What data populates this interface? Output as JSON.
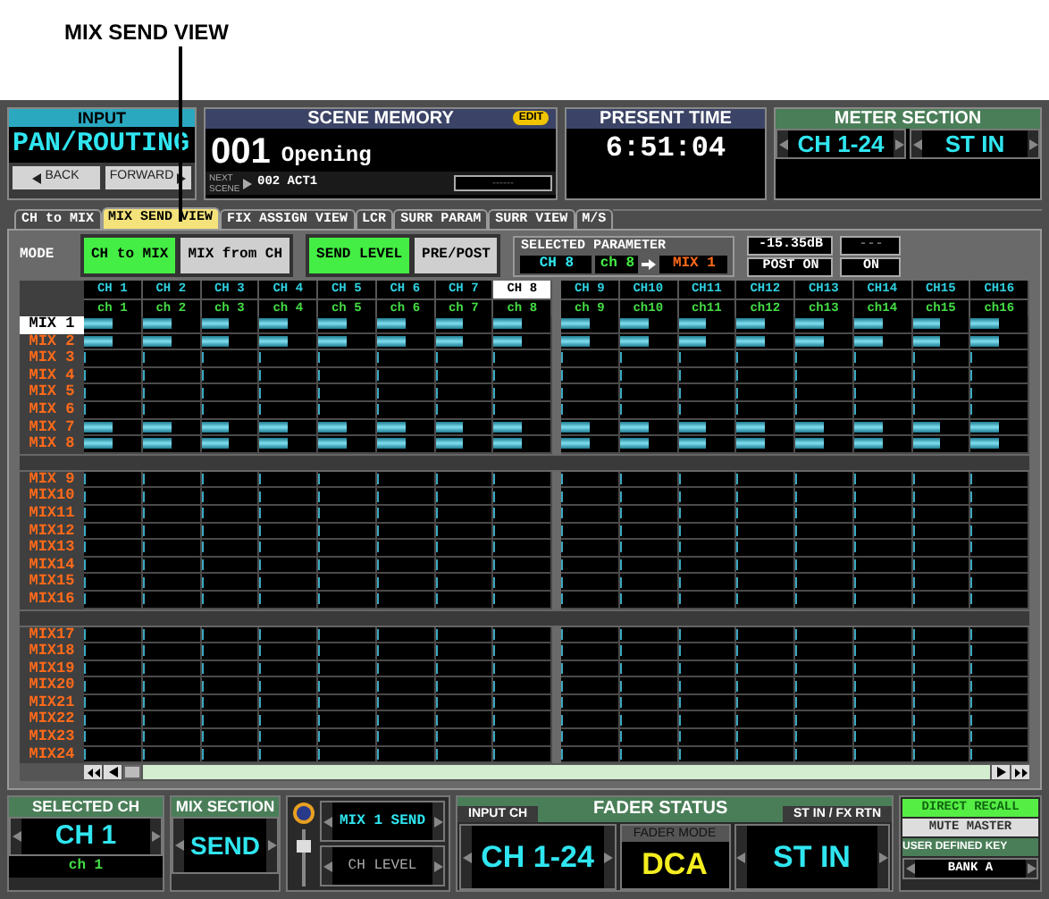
{
  "callout": "MIX SEND VIEW",
  "input_panel": {
    "title": "INPUT",
    "value": "PAN/ROUTING",
    "back": "BACK",
    "forward": "FORWARD"
  },
  "scene_memory": {
    "title": "SCENE MEMORY",
    "badge": "EDIT",
    "number": "001",
    "name": "Opening",
    "next_label": "NEXT SCENE",
    "next": "002 ACT1",
    "field": "------"
  },
  "present_time": {
    "title": "PRESENT TIME",
    "time": "6:51:04"
  },
  "meter_section": {
    "title": "METER SECTION",
    "selectors": [
      "CH 1-24",
      "ST IN"
    ]
  },
  "tabs": [
    {
      "label": "CH to MIX",
      "selected": false
    },
    {
      "label": "MIX SEND VIEW",
      "selected": true
    },
    {
      "label": "FIX ASSIGN VIEW",
      "selected": false
    },
    {
      "label": "LCR",
      "selected": false
    },
    {
      "label": "SURR PARAM",
      "selected": false
    },
    {
      "label": "SURR VIEW",
      "selected": false
    },
    {
      "label": "M/S",
      "selected": false
    }
  ],
  "mode": {
    "label": "MODE",
    "buttons": [
      {
        "label": "CH to MIX",
        "selected": true
      },
      {
        "label": "MIX from CH",
        "selected": false
      }
    ],
    "view_buttons": [
      {
        "label": "SEND LEVEL",
        "selected": true
      },
      {
        "label": "PRE/POST",
        "selected": false
      }
    ]
  },
  "selected_parameter": {
    "title": "SELECTED PARAMETER",
    "channel": "CH 8",
    "name": "ch 8",
    "mix": "MIX 1",
    "value": "-15.35dB",
    "position": "POST ON",
    "value_2": "---",
    "state": "ON"
  },
  "channel_groups": [
    [
      {
        "ch": "CH 1",
        "name": "ch 1",
        "selected": false
      },
      {
        "ch": "CH 2",
        "name": "ch 2",
        "selected": false
      },
      {
        "ch": "CH 3",
        "name": "ch 3",
        "selected": false
      },
      {
        "ch": "CH 4",
        "name": "ch 4",
        "selected": false
      },
      {
        "ch": "CH 5",
        "name": "ch 5",
        "selected": false
      },
      {
        "ch": "CH 6",
        "name": "ch 6",
        "selected": false
      },
      {
        "ch": "CH 7",
        "name": "ch 7",
        "selected": false
      },
      {
        "ch": "CH 8",
        "name": "ch 8",
        "selected": true
      }
    ],
    [
      {
        "ch": "CH 9",
        "name": "ch 9",
        "selected": false
      },
      {
        "ch": "CH10",
        "name": "ch10",
        "selected": false
      },
      {
        "ch": "CH11",
        "name": "ch11",
        "selected": false
      },
      {
        "ch": "CH12",
        "name": "ch12",
        "selected": false
      },
      {
        "ch": "CH13",
        "name": "ch13",
        "selected": false
      },
      {
        "ch": "CH14",
        "name": "ch14",
        "selected": false
      },
      {
        "ch": "CH15",
        "name": "ch15",
        "selected": false
      },
      {
        "ch": "CH16",
        "name": "ch16",
        "selected": false
      }
    ]
  ],
  "mix_groups": [
    [
      {
        "label": "MIX 1",
        "selected": true,
        "level": 0.5
      },
      {
        "label": "MIX 2",
        "selected": false,
        "level": 0.5
      },
      {
        "label": "MIX 3",
        "selected": false,
        "level": 0
      },
      {
        "label": "MIX 4",
        "selected": false,
        "level": 0
      },
      {
        "label": "MIX 5",
        "selected": false,
        "level": 0
      },
      {
        "label": "MIX 6",
        "selected": false,
        "level": 0
      },
      {
        "label": "MIX 7",
        "selected": false,
        "level": 0.5
      },
      {
        "label": "MIX 8",
        "selected": false,
        "level": 0.5
      }
    ],
    [
      {
        "label": "MIX 9",
        "selected": false,
        "level": 0
      },
      {
        "label": "MIX10",
        "selected": false,
        "level": 0
      },
      {
        "label": "MIX11",
        "selected": false,
        "level": 0
      },
      {
        "label": "MIX12",
        "selected": false,
        "level": 0
      },
      {
        "label": "MIX13",
        "selected": false,
        "level": 0
      },
      {
        "label": "MIX14",
        "selected": false,
        "level": 0
      },
      {
        "label": "MIX15",
        "selected": false,
        "level": 0
      },
      {
        "label": "MIX16",
        "selected": false,
        "level": 0
      }
    ],
    [
      {
        "label": "MIX17",
        "selected": false,
        "level": 0
      },
      {
        "label": "MIX18",
        "selected": false,
        "level": 0
      },
      {
        "label": "MIX19",
        "selected": false,
        "level": 0
      },
      {
        "label": "MIX20",
        "selected": false,
        "level": 0
      },
      {
        "label": "MIX21",
        "selected": false,
        "level": 0
      },
      {
        "label": "MIX22",
        "selected": false,
        "level": 0
      },
      {
        "label": "MIX23",
        "selected": false,
        "level": 0
      },
      {
        "label": "MIX24",
        "selected": false,
        "level": 0
      }
    ]
  ],
  "selected_ch": {
    "title": "SELECTED CH",
    "channel": "CH 1",
    "name": "ch 1"
  },
  "mix_section": {
    "title": "MIX SECTION",
    "value": "SEND"
  },
  "encoder": {
    "options": [
      {
        "label": "MIX 1 SEND",
        "selected": true
      },
      {
        "label": "CH LEVEL",
        "selected": false
      }
    ]
  },
  "fader_status": {
    "title": "FADER STATUS",
    "left_tab": "INPUT CH",
    "right_tab": "ST IN / FX RTN",
    "left": "CH 1-24",
    "mode_label": "FADER MODE",
    "mode": "DCA",
    "right": "ST IN"
  },
  "keys": {
    "direct_recall": {
      "label": "DIRECT RECALL",
      "on": true
    },
    "mute_master": {
      "label": "MUTE MASTER",
      "on": false
    },
    "user_label": "USER DEFINED KEY",
    "bank": "BANK A"
  }
}
